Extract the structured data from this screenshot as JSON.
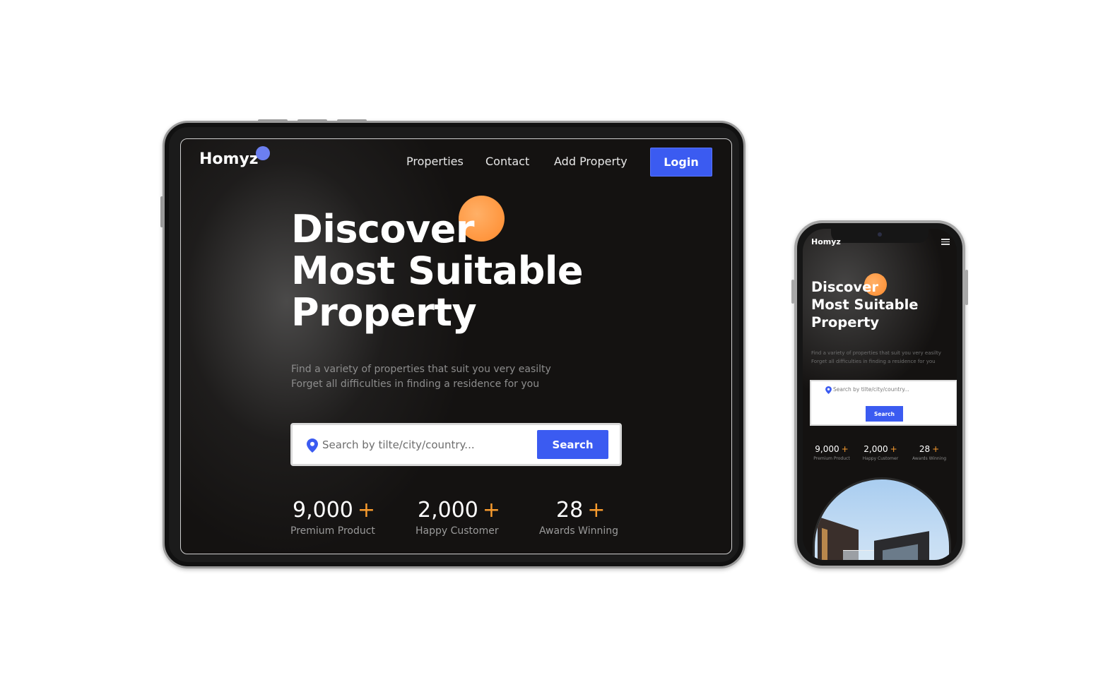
{
  "tablet": {
    "logo": "Homyz",
    "nav": [
      "Properties",
      "Contact",
      "Add Property"
    ],
    "login_label": "Login",
    "hero_title": [
      "Discover",
      "Most Suitable",
      "Property"
    ],
    "hero_subtitle": [
      "Find a variety of properties that suit you very easilty",
      "Forget all difficulties in finding a residence for you"
    ],
    "search": {
      "placeholder": "Search by tilte/city/country...",
      "button_label": "Search"
    },
    "stats": [
      {
        "value": "9,000",
        "plus": "+",
        "label": "Premium Product"
      },
      {
        "value": "2,000",
        "plus": "+",
        "label": "Happy Customer"
      },
      {
        "value": "28",
        "plus": "+",
        "label": "Awards Winning"
      }
    ]
  },
  "phone": {
    "logo": "Homyz",
    "hero_title": [
      "Discover",
      "Most Suitable",
      "Property"
    ],
    "hero_subtitle": [
      "Find a variety of properties that suit you very easilty",
      "Forget all difficulties in finding a residence for you"
    ],
    "search": {
      "placeholder": "Search by tilte/city/country...",
      "button_label": "Search"
    },
    "stats": [
      {
        "value": "9,000",
        "plus": "+",
        "label": "Premium Product"
      },
      {
        "value": "2,000",
        "plus": "+",
        "label": "Happy Customer"
      },
      {
        "value": "28",
        "plus": "+",
        "label": "Awards Winning"
      }
    ]
  },
  "colors": {
    "accent_blue": "#3b5bf1",
    "accent_orange": "#f79b2e",
    "background_dark": "#141211"
  },
  "icons": {
    "location": "location-pin-icon",
    "menu": "hamburger-menu-icon"
  }
}
